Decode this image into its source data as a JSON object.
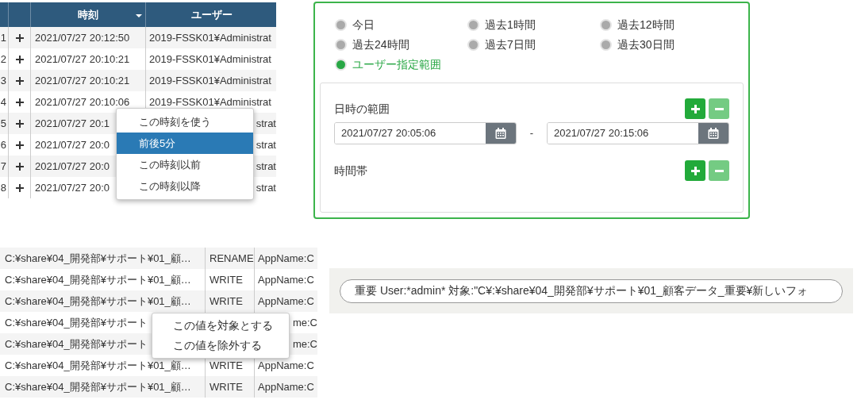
{
  "time_table": {
    "columns": [
      "時刻",
      "ユーザー"
    ],
    "rows": [
      {
        "index": "1",
        "time": "2021/07/27 20:12:50",
        "user": "2019-FSSK01¥Administrat"
      },
      {
        "index": "2",
        "time": "2021/07/27 20:10:21",
        "user": "2019-FSSK01¥Administrat"
      },
      {
        "index": "3",
        "time": "2021/07/27 20:10:21",
        "user": "2019-FSSK01¥Administrat"
      },
      {
        "index": "4",
        "time": "2021/07/27 20:10:06",
        "user": "2019-FSSK01¥Administrat"
      },
      {
        "index": "5",
        "time": "2021/07/27 20:1",
        "user": "strat"
      },
      {
        "index": "6",
        "time": "2021/07/27 20:0",
        "user": "strat"
      },
      {
        "index": "7",
        "time": "2021/07/27 20:0",
        "user": "strat"
      },
      {
        "index": "8",
        "time": "2021/07/27 20:0",
        "user": "strat"
      }
    ]
  },
  "time_menu": {
    "items": [
      {
        "label": "この時刻を使う",
        "selected": false
      },
      {
        "label": "前後5分",
        "selected": true
      },
      {
        "label": "この時刻以前",
        "selected": false
      },
      {
        "label": "この時刻以降",
        "selected": false
      }
    ]
  },
  "period_panel": {
    "options": [
      {
        "label": "今日",
        "selected": false
      },
      {
        "label": "過去1時間",
        "selected": false
      },
      {
        "label": "過去12時間",
        "selected": false
      },
      {
        "label": "過去24時間",
        "selected": false
      },
      {
        "label": "過去7日間",
        "selected": false
      },
      {
        "label": "過去30日間",
        "selected": false
      },
      {
        "label": "ユーザー指定範囲",
        "selected": true
      }
    ],
    "date_range": {
      "label": "日時の範囲",
      "from": "2021/07/27 20:05:06",
      "separator": "-",
      "to": "2021/07/27 20:15:06",
      "remove_disabled": true
    },
    "time_band": {
      "label": "時間帯",
      "remove_disabled": true
    }
  },
  "file_table": {
    "rows": [
      {
        "path": "C:¥share¥04_開発部¥サポート¥01_顧…",
        "operation": "RENAME",
        "detail": "AppName:C"
      },
      {
        "path": "C:¥share¥04_開発部¥サポート¥01_顧…",
        "operation": "WRITE",
        "detail": "AppName:C"
      },
      {
        "path": "C:¥share¥04_開発部¥サポート¥01_顧…",
        "operation": "WRITE",
        "detail": "AppName:C"
      },
      {
        "path": "C:¥share¥04_開発部¥サポート",
        "detail": "me:C"
      },
      {
        "path": "C:¥share¥04_開発部¥サポート",
        "detail": "me:C"
      },
      {
        "path": "C:¥share¥04_開発部¥サポート¥01_顧…",
        "operation": "WRITE",
        "detail": "AppName:C"
      },
      {
        "path": "C:¥share¥04_開発部¥サポート¥01_顧…",
        "operation": "WRITE",
        "detail": "AppName:C"
      }
    ]
  },
  "value_menu": {
    "items": [
      "この値を対象とする",
      "この値を除外する"
    ]
  },
  "filter_chip": {
    "text": "重要 User:*admin* 対象:\"C¥:¥share¥04_開発部¥サポート¥01_顧客データ_重要¥新しいフォ"
  }
}
